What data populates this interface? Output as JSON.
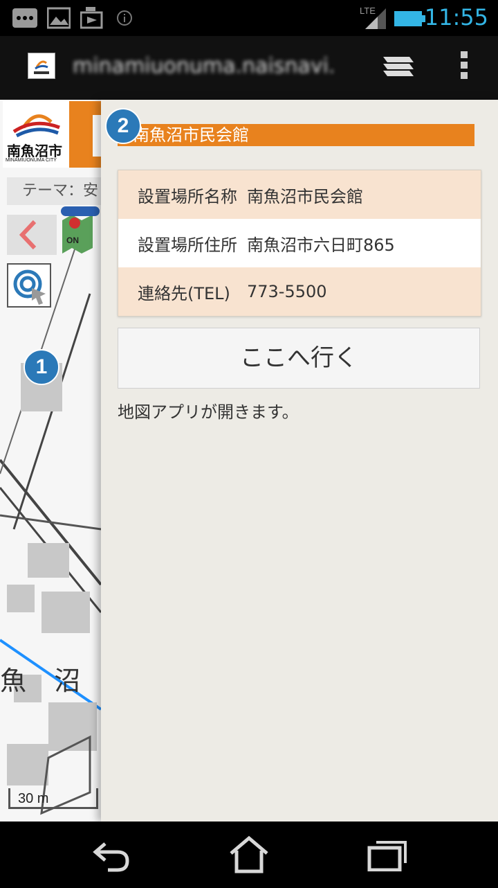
{
  "status_bar": {
    "time": "11:55",
    "network": "LTE",
    "icons": [
      "more-notifications-icon",
      "image-icon",
      "download-icon",
      "info-icon",
      "signal-icon",
      "battery-icon"
    ]
  },
  "browser": {
    "url": "minamiuonuma.naisnavi.",
    "icons": [
      "favicon-icon",
      "tabs-icon",
      "overflow-menu-icon"
    ]
  },
  "map": {
    "logo_text": "南魚沼市",
    "logo_subtext": "MINAMIUONUMA CITY",
    "theme_label": "テーマ：安",
    "layer_toggle_label": "ON",
    "place_label": "魚 沼 警 察",
    "scale": "30 m",
    "badge": "1",
    "colors": {
      "road": "#1e90ff",
      "building": "#c8c8c8"
    }
  },
  "panel": {
    "badge": "2",
    "title": "南魚沼市民会館",
    "rows": [
      {
        "label": "設置場所名称",
        "value": "南魚沼市民会館"
      },
      {
        "label": "設置場所住所",
        "value": "南魚沼市六日町865"
      },
      {
        "label": "連絡先(TEL)",
        "value": "773-5500"
      }
    ],
    "go_button": "ここへ行く",
    "note": "地図アプリが開きます。",
    "colors": {
      "accent": "#e8821e",
      "row_shade": "#f8e3d0",
      "background": "#edebe5"
    }
  },
  "nav_bar": {
    "icons": [
      "back-icon",
      "home-icon",
      "recent-apps-icon"
    ]
  }
}
